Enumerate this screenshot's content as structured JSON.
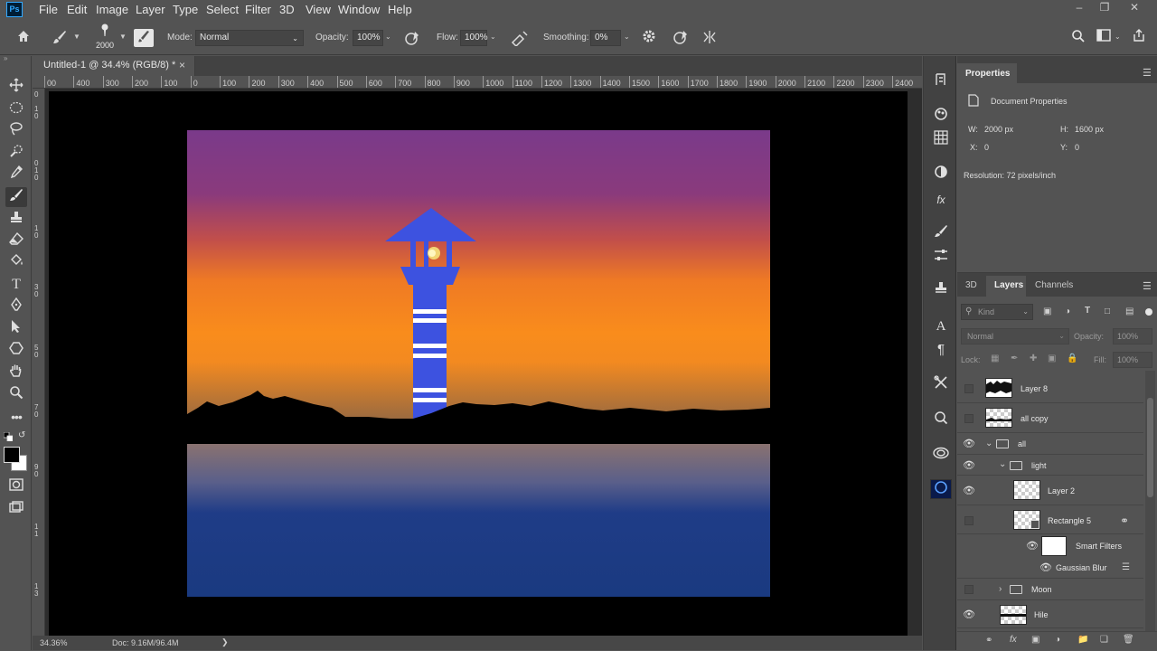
{
  "app": {
    "logo": "Ps"
  },
  "menu": [
    "File",
    "Edit",
    "Image",
    "Layer",
    "Type",
    "Select",
    "Filter",
    "3D",
    "View",
    "Window",
    "Help"
  ],
  "window_controls": [
    "–",
    "❐",
    "✕"
  ],
  "options": {
    "brush_size": "2000",
    "mode_label": "Mode:",
    "mode_value": "Normal",
    "opacity_label": "Opacity:",
    "opacity_value": "100%",
    "flow_label": "Flow:",
    "flow_value": "100%",
    "smoothing_label": "Smoothing:",
    "smoothing_value": "0%"
  },
  "document": {
    "tab_title": "Untitled-1 @ 34.4% (RGB/8) *",
    "close": "×"
  },
  "ruler": {
    "h_ticks": [
      "00",
      "400",
      "300",
      "200",
      "100",
      "0",
      "100",
      "200",
      "300",
      "400",
      "500",
      "600",
      "700",
      "800",
      "900",
      "1000",
      "1100",
      "1200",
      "1300",
      "1400",
      "1500",
      "1600",
      "1700",
      "1800",
      "1900",
      "2000",
      "2100",
      "2200",
      "2300",
      "2400"
    ]
  },
  "status": {
    "zoom": "34.36%",
    "doc": "Doc: 9.16M/96.4M",
    "arrow": "❯"
  },
  "properties": {
    "tab": "Properties",
    "section": "Document Properties",
    "w_label": "W:",
    "w_value": "2000 px",
    "h_label": "H:",
    "h_value": "1600 px",
    "x_label": "X:",
    "x_value": "0",
    "y_label": "Y:",
    "y_value": "0",
    "resolution": "Resolution: 72 pixels/inch"
  },
  "layers_panel": {
    "tabs": [
      "3D",
      "Layers",
      "Channels"
    ],
    "kind": "Kind",
    "blend": "Normal",
    "opacity_label": "Opacity:",
    "opacity_value": "100%",
    "lock_label": "Lock:",
    "fill_label": "Fill:",
    "fill_value": "100%",
    "layers": [
      {
        "name": "Layer 8",
        "visible": false
      },
      {
        "name": "all copy",
        "visible": false
      },
      {
        "name": "all",
        "visible": true
      },
      {
        "name": "light",
        "visible": true
      },
      {
        "name": "Layer 2",
        "visible": true
      },
      {
        "name": "Rectangle 5",
        "visible": false
      },
      {
        "name": "Smart Filters",
        "visible": true
      },
      {
        "name": "Gaussian Blur",
        "visible": true
      },
      {
        "name": "Moon",
        "visible": false
      },
      {
        "name": "Hile",
        "visible": true
      }
    ],
    "footer_fx": "fx"
  },
  "colors": {
    "accent_blue": "#31a8ff",
    "lighthouse": "#3d52e0",
    "sky_top": "#7a3a8a",
    "sky_mid": "#f98c1c",
    "water": "#1a3a80"
  }
}
